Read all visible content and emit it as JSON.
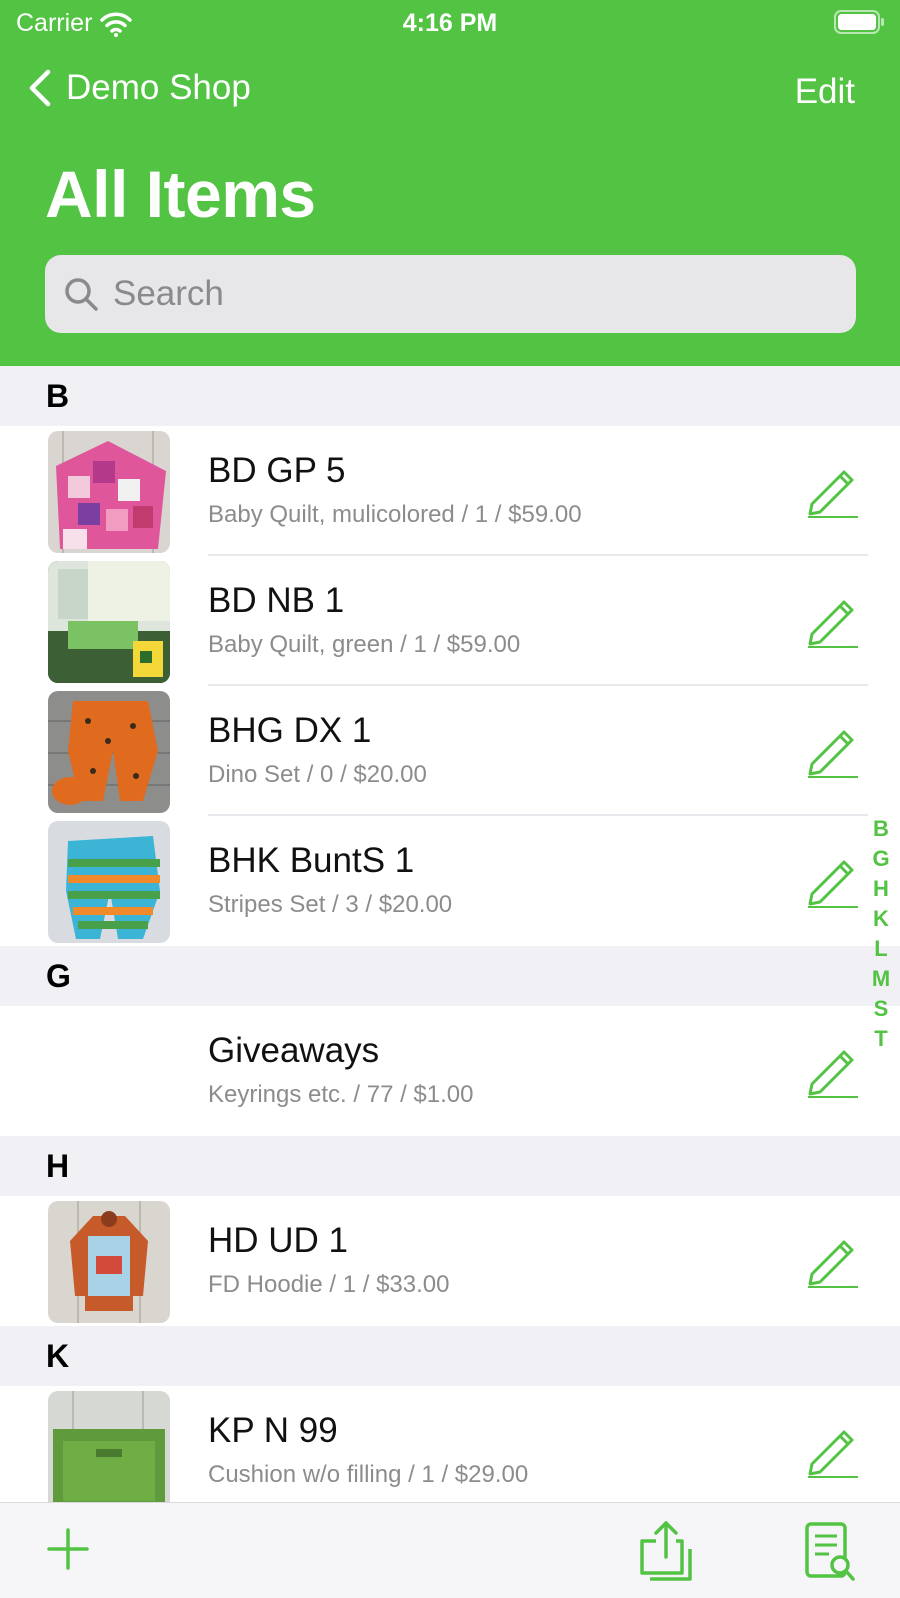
{
  "status_bar": {
    "carrier": "Carrier",
    "time": "4:16 PM"
  },
  "nav": {
    "back_label": "Demo Shop",
    "edit_label": "Edit",
    "title": "All Items"
  },
  "search": {
    "placeholder": "Search"
  },
  "sections": [
    {
      "letter": "B",
      "items": [
        {
          "title": "BD GP 5",
          "subtitle": "Baby Quilt, mulicolored / 1 / $59.00"
        },
        {
          "title": "BD NB 1",
          "subtitle": "Baby Quilt, green / 1 / $59.00"
        },
        {
          "title": "BHG DX 1",
          "subtitle": "Dino Set / 0 / $20.00"
        },
        {
          "title": "BHK BuntS 1",
          "subtitle": "Stripes Set / 3 / $20.00"
        }
      ]
    },
    {
      "letter": "G",
      "items": [
        {
          "title": "Giveaways",
          "subtitle": "Keyrings etc. / 77 / $1.00"
        }
      ]
    },
    {
      "letter": "H",
      "items": [
        {
          "title": "HD UD 1",
          "subtitle": "FD Hoodie / 1 / $33.00"
        }
      ]
    },
    {
      "letter": "K",
      "items": [
        {
          "title": "KP N 99",
          "subtitle": "Cushion w/o filling / 1 / $29.00"
        }
      ]
    }
  ],
  "section_index": [
    "B",
    "G",
    "H",
    "K",
    "L",
    "M",
    "S",
    "T"
  ],
  "colors": {
    "accent": "#52c343",
    "section_bg": "#f1f1f5",
    "subtitle": "#8c8c8f"
  },
  "icons": {
    "toolbar": [
      "plus-icon",
      "share-icon",
      "document-search-icon"
    ],
    "row": "pencil-icon"
  }
}
